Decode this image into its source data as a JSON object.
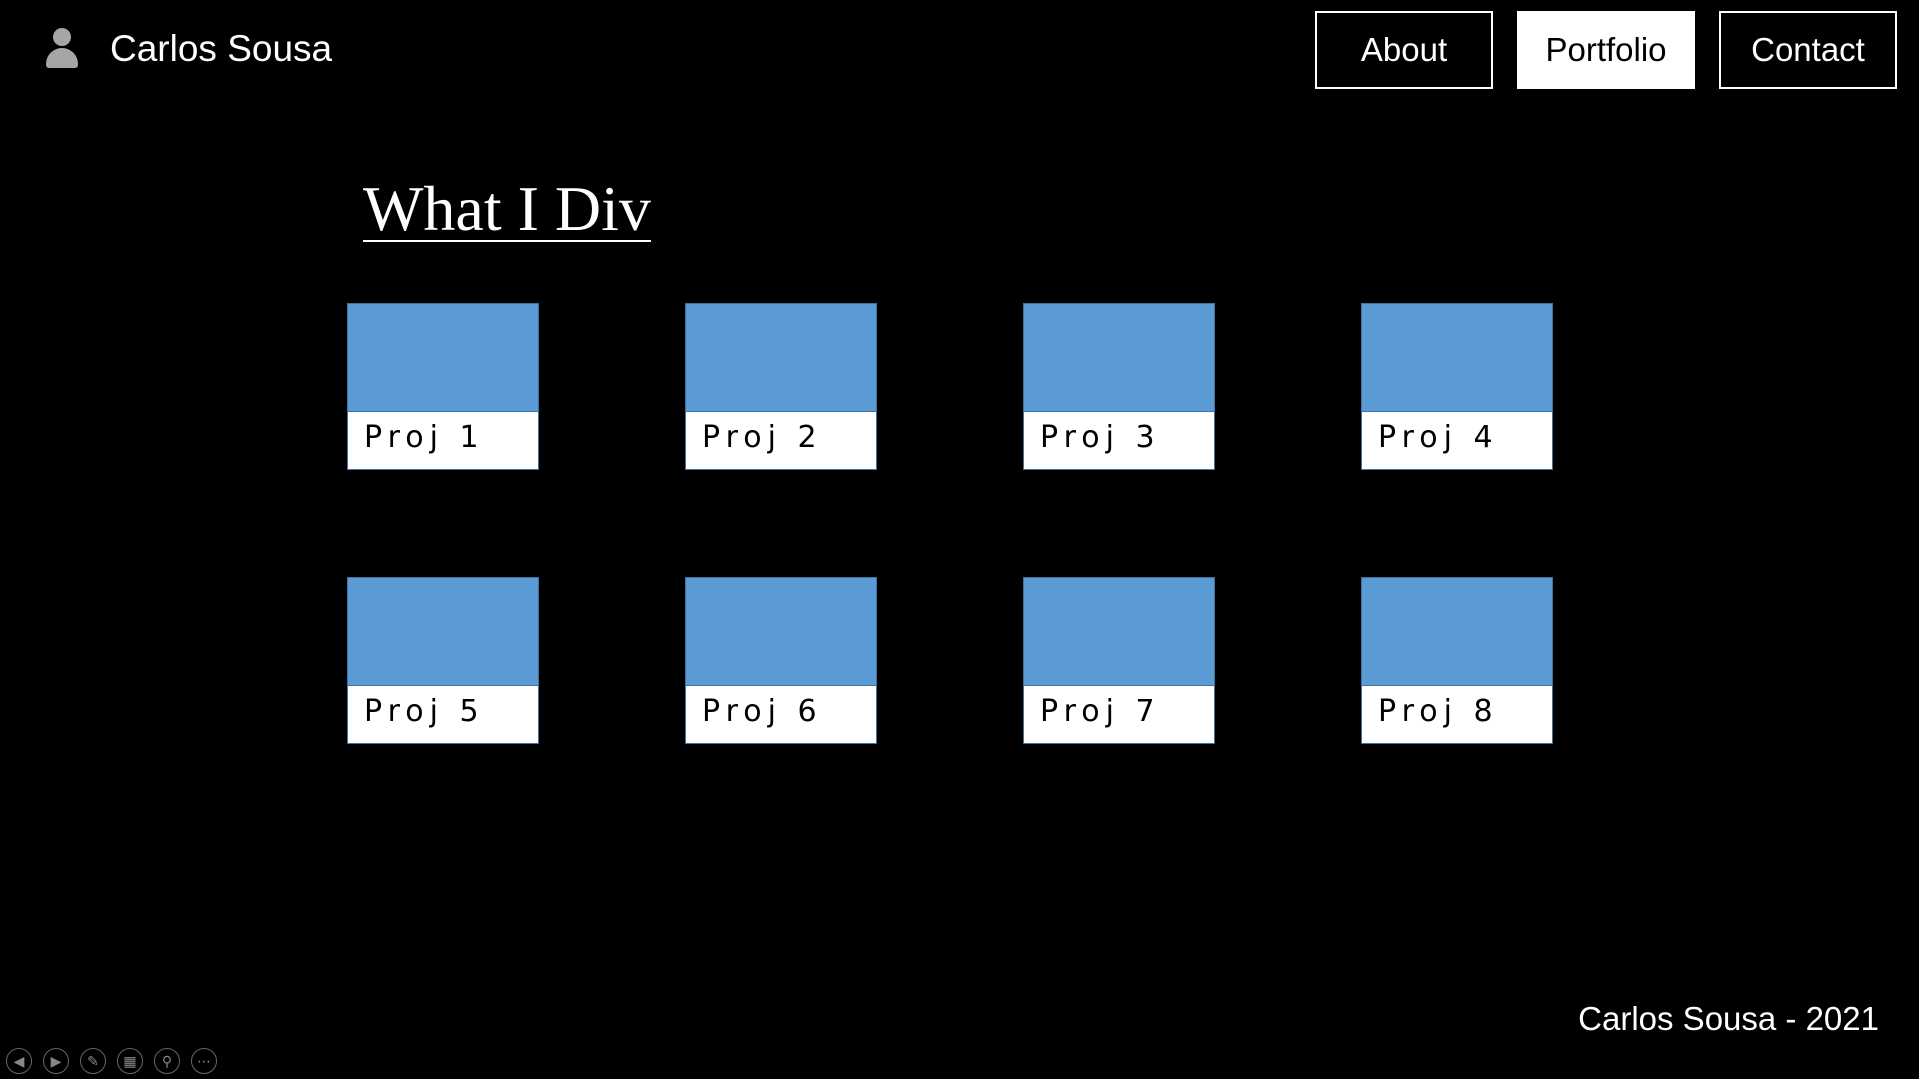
{
  "header": {
    "brand_name": "Carlos Sousa",
    "icon": "person-icon"
  },
  "nav": [
    {
      "label": "About",
      "active": false
    },
    {
      "label": "Portfolio",
      "active": true
    },
    {
      "label": "Contact",
      "active": false
    }
  ],
  "main": {
    "title": "What I Div",
    "projects": [
      {
        "label": "Proj 1"
      },
      {
        "label": "Proj 2"
      },
      {
        "label": "Proj 3"
      },
      {
        "label": "Proj 4"
      },
      {
        "label": "Proj 5"
      },
      {
        "label": "Proj 6"
      },
      {
        "label": "Proj 7"
      },
      {
        "label": "Proj 8"
      }
    ]
  },
  "footer": {
    "text": "Carlos Sousa - 2021"
  },
  "slideshow_controls": [
    {
      "icon": "previous-icon"
    },
    {
      "icon": "next-icon"
    },
    {
      "icon": "pen-icon"
    },
    {
      "icon": "slides-grid-icon"
    },
    {
      "icon": "zoom-icon"
    },
    {
      "icon": "more-icon"
    }
  ],
  "colors": {
    "background": "#000000",
    "thumbnail": "#5b9bd5",
    "card_border": "#41719c",
    "text": "#ffffff"
  }
}
